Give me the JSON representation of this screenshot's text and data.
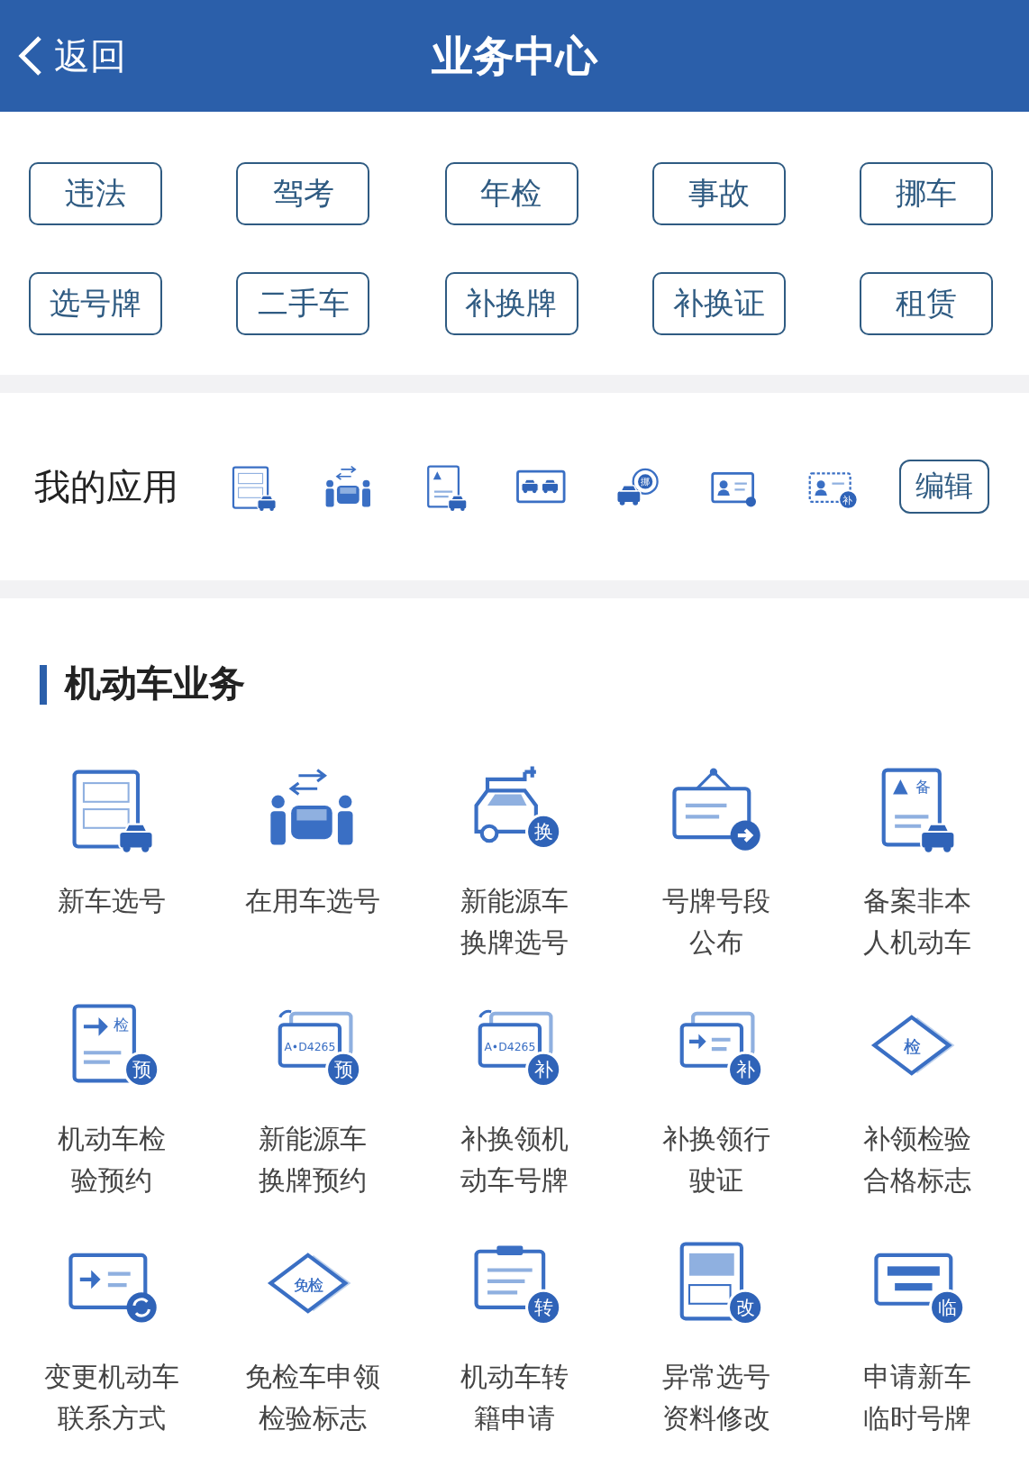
{
  "header": {
    "back": "返回",
    "title": "业务中心"
  },
  "quick": [
    "违法",
    "驾考",
    "年检",
    "事故",
    "挪车",
    "选号牌",
    "二手车",
    "补换牌",
    "补换证",
    "租赁"
  ],
  "my_apps": {
    "label": "我的应用",
    "apps": [
      {
        "kind": "doc-car"
      },
      {
        "kind": "people-car"
      },
      {
        "kind": "profile-car"
      },
      {
        "kind": "photo-cars"
      },
      {
        "kind": "car-bubble",
        "badge": "挪"
      },
      {
        "kind": "card-dot"
      },
      {
        "kind": "card-dashed",
        "badge": "补"
      }
    ],
    "edit": "编辑"
  },
  "section": {
    "title": "机动车业务",
    "services": [
      {
        "kind": "doc-car",
        "label": [
          "新车选号"
        ]
      },
      {
        "kind": "people-car",
        "label": [
          "在用车选号"
        ]
      },
      {
        "kind": "ev-car",
        "label": [
          "新能源车",
          "换牌选号"
        ],
        "badge": "换"
      },
      {
        "kind": "board",
        "label": [
          "号牌号段",
          "公布"
        ]
      },
      {
        "kind": "profile-car",
        "label": [
          "备案非本",
          "人机动车"
        ],
        "badge": "备"
      },
      {
        "kind": "doc-badge",
        "label": [
          "机动车检",
          "验预约"
        ],
        "mark": "检",
        "badge": "预"
      },
      {
        "kind": "plates",
        "label": [
          "新能源车",
          "换牌预约"
        ],
        "plate": "A•D4265",
        "badge": "预"
      },
      {
        "kind": "plates",
        "label": [
          "补换领机",
          "动车号牌"
        ],
        "plate": "A•D4265",
        "badge": "补"
      },
      {
        "kind": "card-cycle",
        "label": [
          "补换领行",
          "驶证"
        ],
        "badge": "补"
      },
      {
        "kind": "diamond",
        "label": [
          "补领检验",
          "合格标志"
        ],
        "mark": "检"
      },
      {
        "kind": "card-refresh",
        "label": [
          "变更机动车",
          "联系方式"
        ]
      },
      {
        "kind": "diamond",
        "label": [
          "免检车申领",
          "检验标志"
        ],
        "mark": "免检"
      },
      {
        "kind": "clipboard",
        "label": [
          "机动车转",
          "籍申请"
        ],
        "badge": "转"
      },
      {
        "kind": "form",
        "label": [
          "异常选号",
          "资料修改"
        ],
        "badge": "改"
      },
      {
        "kind": "plate-lines",
        "label": [
          "申请新车",
          "临时号牌"
        ],
        "badge": "临"
      }
    ]
  }
}
